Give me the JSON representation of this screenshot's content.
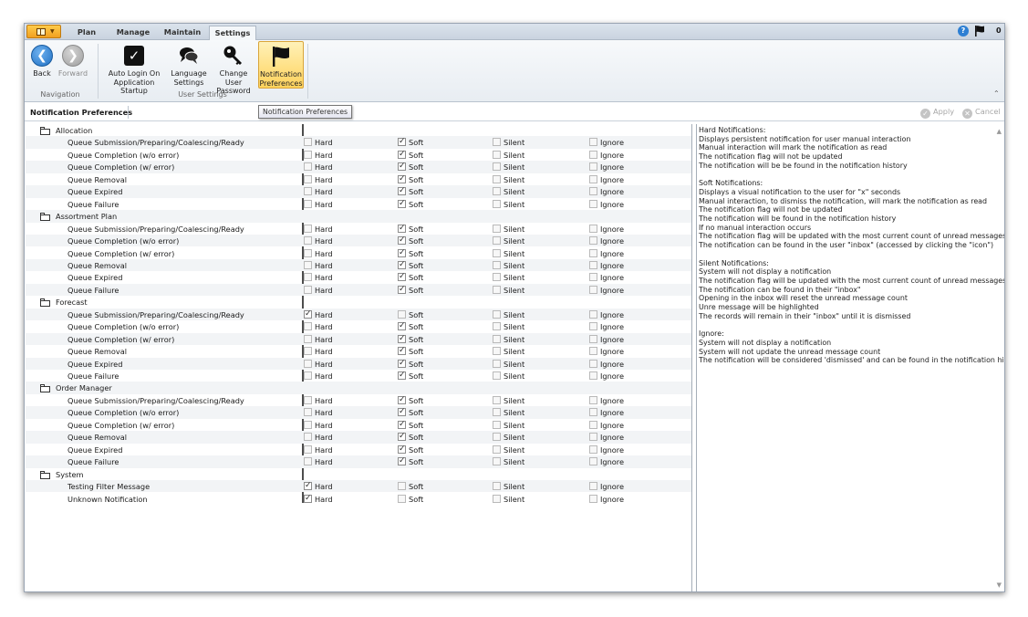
{
  "topbar": {
    "tabs": [
      "Plan",
      "Manage",
      "Maintain",
      "Settings"
    ],
    "active_tab": "Settings",
    "notification_count": "0"
  },
  "ribbon": {
    "navigation": {
      "back_label": "Back",
      "forward_label": "Forward",
      "group_label": "Navigation"
    },
    "user_settings": {
      "auto_login_label_1": "Auto Login On",
      "auto_login_label_2": "Application Startup",
      "language_label_1": "Language",
      "language_label_2": "Settings",
      "password_label_1": "Change User",
      "password_label_2": "Password",
      "notif_label_1": "Notification",
      "notif_label_2": "Preferences",
      "group_label": "User Settings"
    }
  },
  "header": {
    "title": "Notification Preferences",
    "tooltip": "Notification Preferences",
    "apply_label": "Apply",
    "cancel_label": "Cancel"
  },
  "options": [
    "Hard",
    "Soft",
    "Silent",
    "Ignore"
  ],
  "categories": [
    {
      "name": "Allocation",
      "items": [
        {
          "label": "Queue Submission/Preparing/Coalescing/Ready",
          "selected": "Soft"
        },
        {
          "label": "Queue Completion (w/o error)",
          "selected": "Soft"
        },
        {
          "label": "Queue Completion (w/ error)",
          "selected": "Soft"
        },
        {
          "label": "Queue Removal",
          "selected": "Soft"
        },
        {
          "label": "Queue Expired",
          "selected": "Soft"
        },
        {
          "label": "Queue Failure",
          "selected": "Soft"
        }
      ]
    },
    {
      "name": "Assortment Plan",
      "items": [
        {
          "label": "Queue Submission/Preparing/Coalescing/Ready",
          "selected": "Soft"
        },
        {
          "label": "Queue Completion (w/o error)",
          "selected": "Soft"
        },
        {
          "label": "Queue Completion (w/ error)",
          "selected": "Soft"
        },
        {
          "label": "Queue Removal",
          "selected": "Soft"
        },
        {
          "label": "Queue Expired",
          "selected": "Soft"
        },
        {
          "label": "Queue Failure",
          "selected": "Soft"
        }
      ]
    },
    {
      "name": "Forecast",
      "items": [
        {
          "label": "Queue Submission/Preparing/Coalescing/Ready",
          "selected": "Hard"
        },
        {
          "label": "Queue Completion (w/o error)",
          "selected": "Soft"
        },
        {
          "label": "Queue Completion (w/ error)",
          "selected": "Soft"
        },
        {
          "label": "Queue Removal",
          "selected": "Soft"
        },
        {
          "label": "Queue Expired",
          "selected": "Soft"
        },
        {
          "label": "Queue Failure",
          "selected": "Soft"
        }
      ]
    },
    {
      "name": "Order Manager",
      "items": [
        {
          "label": "Queue Submission/Preparing/Coalescing/Ready",
          "selected": "Soft"
        },
        {
          "label": "Queue Completion (w/o error)",
          "selected": "Soft"
        },
        {
          "label": "Queue Completion (w/ error)",
          "selected": "Soft"
        },
        {
          "label": "Queue Removal",
          "selected": "Soft"
        },
        {
          "label": "Queue Expired",
          "selected": "Soft"
        },
        {
          "label": "Queue Failure",
          "selected": "Soft"
        }
      ]
    },
    {
      "name": "System",
      "items": [
        {
          "label": "Testing Filter Message",
          "selected": "Hard"
        },
        {
          "label": "Unknown Notification",
          "selected": "Hard"
        }
      ]
    }
  ],
  "help_lines": [
    "Hard Notifications:",
    "Displays persistent notification for user manual interaction",
    "Manual interaction will mark the notification as read",
    "The notification flag will not be updated",
    "The notification will be be found in the notification history",
    "",
    "Soft Notifications:",
    "Displays a visual notification to the user for \"x\" seconds",
    "Manual interaction, to dismiss the notification, will mark the notification as read",
    "The notification flag will not be updated",
    "The notification will be found in the notification history",
    "If no manual interaction occurs",
    "The notification flag will be updated with the most current count of unread messages",
    "The notification can be found in the user \"inbox\" (accessed by clicking the \"icon\")",
    "",
    "Silent Notifications:",
    "System will not display a notification",
    "The notification flag will be updated with the most current count of unread messages",
    "The notification can be found in their \"inbox\"",
    "Opening in the inbox will reset the unread message count",
    "Unre message will be highlighted",
    "The records will remain in their \"inbox\" until it is dismissed",
    "",
    "Ignore:",
    "System will not display a notification",
    "System will not update the unread message count",
    "The notification will be considered 'dismissed' and can be found in the notification history"
  ]
}
